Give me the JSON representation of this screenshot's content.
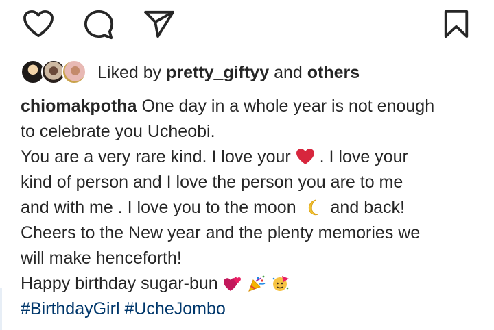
{
  "actions": {
    "like_icon": "heart-outline",
    "comment_icon": "comment-bubble",
    "share_icon": "paper-plane",
    "save_icon": "bookmark-outline"
  },
  "likes": {
    "prefix": "Liked by",
    "user": "pretty_giftyy",
    "middle": "and",
    "others": "others"
  },
  "caption": {
    "username": "chiomakpotha",
    "line1": "One day in a whole year is not enough",
    "line2": "to celebrate you Ucheobi.",
    "line3a": "You are a very rare kind. I love your",
    "line3b": ". I love your",
    "line4": "kind of person and I love the person you are to me",
    "line5a": "and with me . I love you to the moon",
    "line5b": "and back!",
    "line6": "Cheers to the New year and the plenty memories we",
    "line7": "will make henceforth!",
    "line8": "Happy birthday sugar-bun",
    "hashtag1": "#BirthdayGirl",
    "hashtag2": "#UcheJombo"
  },
  "colors": {
    "text": "#262626",
    "hashtag": "#00376b",
    "heart": "#d7263d"
  }
}
